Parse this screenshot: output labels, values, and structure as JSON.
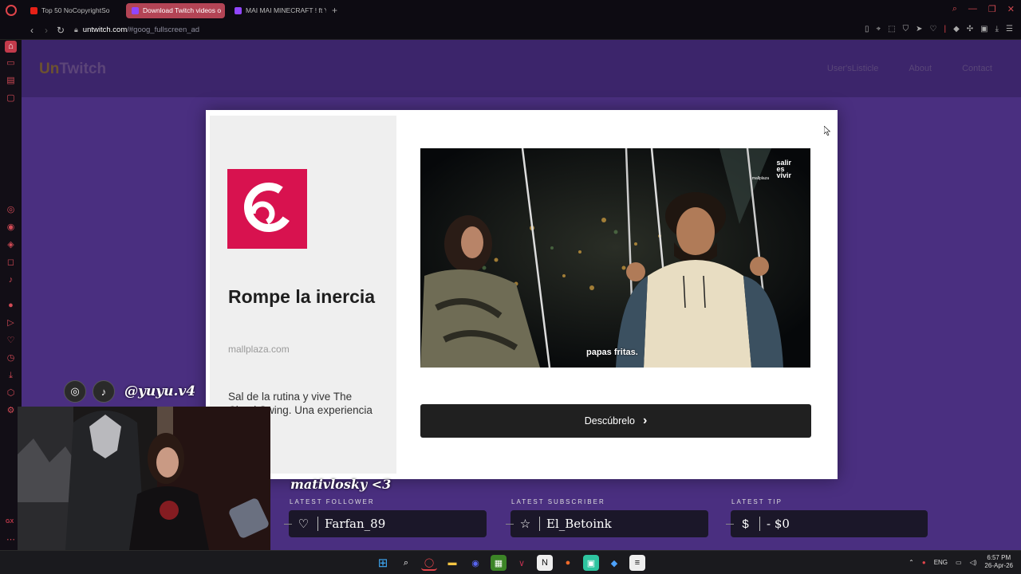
{
  "browser": {
    "tabs": [
      {
        "label": "Top 50 NoCopyrightSo",
        "fav_color": "#e62117"
      },
      {
        "label": "Download Twitch videos o",
        "fav_color": "#9146ff"
      },
      {
        "label": "MAI MAI MINECRAFT ! ft Y",
        "fav_color": "#9146ff"
      }
    ],
    "new_tab": "+",
    "url_host": "untwitch.com",
    "url_path": "/#goog_fullscreen_ad"
  },
  "site": {
    "logo_part1": "Un",
    "logo_part2": "Twitch",
    "nav": [
      "User'sListicle",
      "About",
      "Contact"
    ]
  },
  "ad": {
    "title": "Rompe la inercia",
    "domain": "mallplaza.com",
    "body": "Sal de la rutina y vive The Cloud Swing. Una experiencia única.",
    "video_watermark": "salir\nes\nvivir",
    "video_sublogo": "mallplaza",
    "video_caption": "papas fritas.",
    "cta_label": "Descúbrelo"
  },
  "overlay": {
    "handle": "@yuyu.v4",
    "mention": "mativlosky <3",
    "latest_follower_label": "LATEST FOLLOWER",
    "latest_follower": "Farfan_89",
    "latest_subscriber_label": "LATEST SUBSCRIBER",
    "latest_subscriber": "El_Betoink",
    "latest_tip_label": "LATEST TIP",
    "latest_tip": "- $0"
  },
  "taskbar": {
    "lang": "ENG",
    "time": "6:57 PM",
    "date": "26-Apr-26"
  },
  "colors": {
    "accent_tab": "#b34455",
    "brand_pink": "#d8124f",
    "page_purple": "#4a2f80"
  }
}
